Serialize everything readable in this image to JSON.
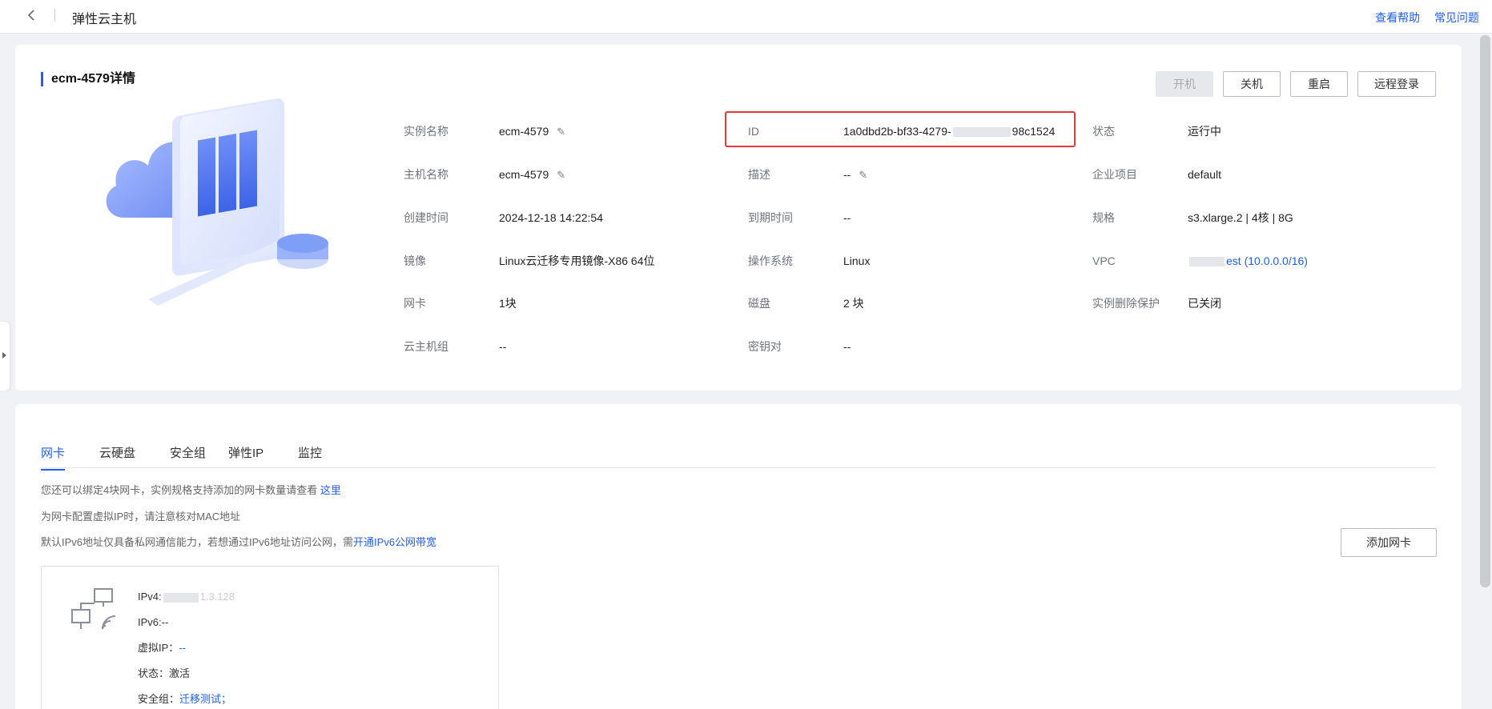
{
  "topbar": {
    "title": "弹性云主机",
    "help": "查看帮助",
    "faq": "常见问题"
  },
  "detail": {
    "title": "ecm-4579详情",
    "actions": {
      "start": "开机",
      "stop": "关机",
      "restart": "重启",
      "remote": "远程登录"
    },
    "col1": [
      {
        "label": "实例名称",
        "value": "ecm-4579",
        "editable": true
      },
      {
        "label": "主机名称",
        "value": "ecm-4579",
        "editable": true
      },
      {
        "label": "创建时间",
        "value": "2024-12-18 14:22:54"
      },
      {
        "label": "镜像",
        "value": "Linux云迁移专用镜像-X86 64位"
      },
      {
        "label": "网卡",
        "value": "1块"
      },
      {
        "label": "云主机组",
        "value": "--"
      }
    ],
    "col2": [
      {
        "label": "ID",
        "value_prefix": "1a0dbd2b-bf33-4279-",
        "value_suffix": "98c1524"
      },
      {
        "label": "描述",
        "value": "--",
        "editable": true
      },
      {
        "label": "到期时间",
        "value": "--"
      },
      {
        "label": "操作系统",
        "value": "Linux"
      },
      {
        "label": "磁盘",
        "value": "2 块"
      },
      {
        "label": "密钥对",
        "value": "--"
      }
    ],
    "col3": [
      {
        "label": "状态",
        "value": "运行中"
      },
      {
        "label": "企业项目",
        "value": "default"
      },
      {
        "label": "规格",
        "value": "s3.xlarge.2 | 4核 | 8G"
      },
      {
        "label": "VPC",
        "value": "est (10.0.0.0/16)"
      },
      {
        "label": "实例删除保护",
        "value": "已关闭"
      }
    ]
  },
  "tabs": [
    "网卡",
    "云硬盘",
    "安全组",
    "弹性IP",
    "监控"
  ],
  "nic_section": {
    "note1": "您还可以绑定4块网卡，实例规格支持添加的网卡数量请查看",
    "note1_link": "这里",
    "note2": "为网卡配置虚拟IP时，请注意核对MAC地址",
    "note3": "默认IPv6地址仅具备私网通信能力，若想通过IPv6地址访问公网，需",
    "note3_link": "开通IPv6公网带宽",
    "add_button": "添加网卡",
    "card": {
      "ipv4_label": "IPv4:",
      "ipv4_tail": "1.3.128",
      "ipv6": "IPv6:--",
      "vip_label": "虚拟IP：",
      "vip_value": "--",
      "status_label": "状态：",
      "status_value": "激活",
      "sg_label": "安全组：",
      "sg_value": "迁移测试；"
    }
  }
}
